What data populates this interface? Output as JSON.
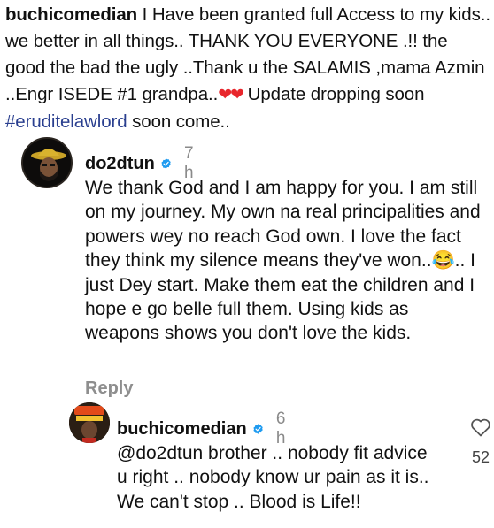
{
  "post": {
    "username": "buchicomedian",
    "caption_part1": " I Have been granted full Access to my kids.. we better in all things.. THANK YOU EVERYONE .!! the good the bad the ugly ..Thank u the SALAMIS ,mama Azmin ..Engr ISEDE #1 grandpa..",
    "caption_part2": " Update dropping soon ",
    "hashtag": "#eruditelawlord",
    "caption_part3": " soon come..",
    "hearts": "❤❤"
  },
  "comments": [
    {
      "username": "do2dtun",
      "time": "7 h",
      "text": "We thank God and I am happy for you. I am still on my journey. My own na real principalities and powers wey no reach God own. I love the fact they think my silence means they've won..😂.. I just Dey start. Make them eat the children and I hope e go belle full them. Using kids as weapons shows you don't love the kids.",
      "reply_label": "Reply"
    },
    {
      "username": "buchicomedian",
      "time": "6 h",
      "text": "@do2dtun brother .. nobody fit advice u right .. nobody know ur pain as it is.. We can't stop .. Blood is Life!!",
      "likes": "52"
    }
  ],
  "icons": {
    "verified": "verified-badge-icon",
    "like": "heart-outline-icon"
  },
  "colors": {
    "verified_blue": "#1f9bf0",
    "hashtag": "#2a3f8f",
    "heart_red": "#e8262c",
    "muted": "#8e8e8e"
  }
}
